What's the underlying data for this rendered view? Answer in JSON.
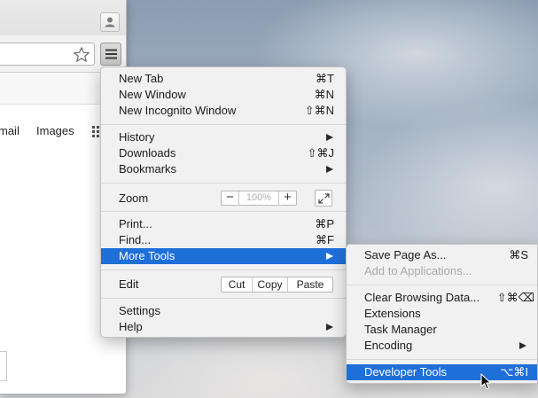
{
  "browser": {
    "page_links": [
      "mail",
      "Images"
    ]
  },
  "main_menu": {
    "new_tab": {
      "label": "New Tab",
      "shortcut": "⌘T"
    },
    "new_window": {
      "label": "New Window",
      "shortcut": "⌘N"
    },
    "new_incognito": {
      "label": "New Incognito Window",
      "shortcut": "⇧⌘N"
    },
    "history": {
      "label": "History"
    },
    "downloads": {
      "label": "Downloads",
      "shortcut": "⇧⌘J"
    },
    "bookmarks": {
      "label": "Bookmarks"
    },
    "zoom": {
      "label": "Zoom",
      "minus": "−",
      "level": "100%",
      "plus": "+"
    },
    "print": {
      "label": "Print...",
      "shortcut": "⌘P"
    },
    "find": {
      "label": "Find...",
      "shortcut": "⌘F"
    },
    "more_tools": {
      "label": "More Tools"
    },
    "edit": {
      "label": "Edit",
      "cut": "Cut",
      "copy": "Copy",
      "paste": "Paste"
    },
    "settings": {
      "label": "Settings"
    },
    "help": {
      "label": "Help"
    }
  },
  "sub_menu": {
    "save_page": {
      "label": "Save Page As...",
      "shortcut": "⌘S"
    },
    "add_to_apps": {
      "label": "Add to Applications..."
    },
    "clear_data": {
      "label": "Clear Browsing Data...",
      "shortcut": "⇧⌘⌫"
    },
    "extensions": {
      "label": "Extensions"
    },
    "task_manager": {
      "label": "Task Manager"
    },
    "encoding": {
      "label": "Encoding"
    },
    "developer_tools": {
      "label": "Developer Tools",
      "shortcut": "⌥⌘I"
    }
  },
  "icons": {
    "star": "star-icon",
    "menu": "hamburger-menu-icon",
    "profile": "profile-icon",
    "apps": "apps-grid-icon",
    "fullscreen": "fullscreen-icon",
    "cursor": "mouse-cursor-icon"
  },
  "colors": {
    "highlight": "#1f6fd9",
    "disabled_text": "#a8a8a8"
  }
}
